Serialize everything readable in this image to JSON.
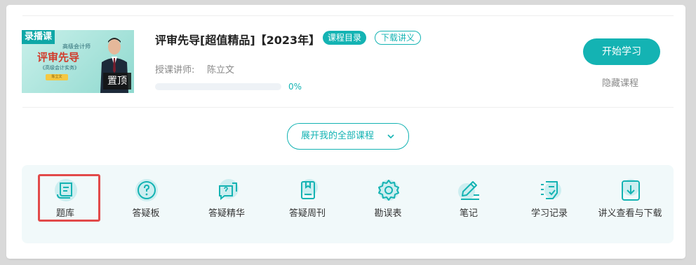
{
  "course": {
    "thumbnail": {
      "record_tag": "录播课",
      "line_small_1": "高级会计师",
      "line_big": "评审先导",
      "line_small_2": "《高级会计实务》",
      "pill_text": "陈立文",
      "pin_label": "置顶"
    },
    "title": "评审先导[超值精品]【2023年】",
    "catalog_button": "课程目录",
    "handout_button": "下载讲义",
    "lecturer_label": "授课讲师:",
    "lecturer_name": "陈立文",
    "progress_percent": 0,
    "progress_text": "0%",
    "start_button": "开始学习",
    "hide_link": "隐藏课程"
  },
  "expand_button": "展开我的全部课程",
  "tools": [
    {
      "label": "题库",
      "icon": "question-bank-icon"
    },
    {
      "label": "答疑板",
      "icon": "qa-board-icon"
    },
    {
      "label": "答疑精华",
      "icon": "qa-highlights-icon"
    },
    {
      "label": "答疑周刊",
      "icon": "qa-weekly-icon"
    },
    {
      "label": "勘误表",
      "icon": "errata-icon"
    },
    {
      "label": "笔记",
      "icon": "notes-icon"
    },
    {
      "label": "学习记录",
      "icon": "study-record-icon"
    },
    {
      "label": "讲义查看与下载",
      "icon": "handout-download-icon"
    }
  ],
  "colors": {
    "accent": "#14b3b3",
    "highlight_border": "#e24a4a",
    "panel_bg": "#f1f9fa"
  }
}
